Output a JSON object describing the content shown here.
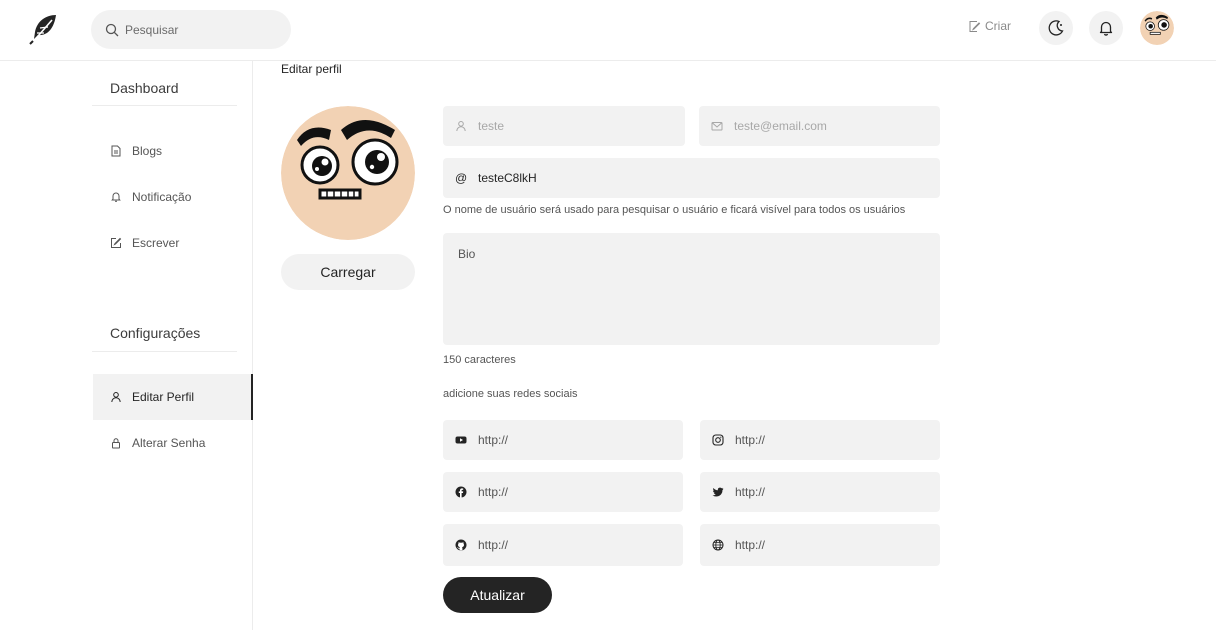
{
  "header": {
    "search_placeholder": "Pesquisar",
    "create_label": "Criar"
  },
  "sidebar": {
    "dashboard_heading": "Dashboard",
    "main_items": [
      {
        "label": "Blogs",
        "icon": "document-icon"
      },
      {
        "label": "Notificação",
        "icon": "bell-icon"
      },
      {
        "label": "Escrever",
        "icon": "edit-icon"
      }
    ],
    "settings_heading": "Configurações",
    "settings_items": [
      {
        "label": "Editar Perfil",
        "icon": "user-icon",
        "active": true
      },
      {
        "label": "Alterar Senha",
        "icon": "lock-icon",
        "active": false
      }
    ]
  },
  "main": {
    "page_title": "Editar perfil",
    "upload_label": "Carregar",
    "fullname_value": "teste",
    "email_value": "teste@email.com",
    "username_value": "testeC8lkH",
    "username_hint": "O nome de usuário será usado para pesquisar o usuário e ficará visível para todos os usuários",
    "bio_placeholder": "Bio",
    "bio_counter": "150 caracteres",
    "social_heading": "adicione suas redes sociais",
    "social_links": [
      {
        "network": "youtube",
        "placeholder": "http://"
      },
      {
        "network": "instagram",
        "placeholder": "http://"
      },
      {
        "network": "facebook",
        "placeholder": "http://"
      },
      {
        "network": "twitter",
        "placeholder": "http://"
      },
      {
        "network": "github",
        "placeholder": "http://"
      },
      {
        "network": "website",
        "placeholder": "http://"
      }
    ],
    "update_label": "Atualizar"
  },
  "colors": {
    "accent_dark": "#242424",
    "field_bg": "#f2f2f2",
    "avatar_skin": "#f2d2b4"
  }
}
